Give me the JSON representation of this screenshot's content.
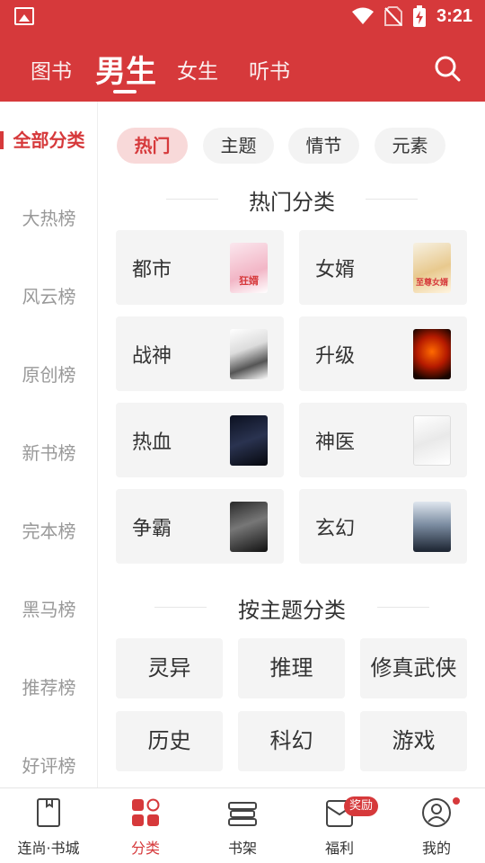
{
  "status_bar": {
    "time": "3:21"
  },
  "header": {
    "tabs": [
      {
        "label": "图书",
        "active": false
      },
      {
        "label": "男生",
        "active": true
      },
      {
        "label": "女生",
        "active": false
      },
      {
        "label": "听书",
        "active": false
      }
    ],
    "search_icon": "search-icon"
  },
  "sidebar": {
    "items": [
      {
        "label": "全部分类",
        "active": true
      },
      {
        "label": "大热榜"
      },
      {
        "label": "风云榜"
      },
      {
        "label": "原创榜"
      },
      {
        "label": "新书榜"
      },
      {
        "label": "完本榜"
      },
      {
        "label": "黑马榜"
      },
      {
        "label": "推荐榜"
      },
      {
        "label": "好评榜"
      }
    ]
  },
  "chips": [
    {
      "label": "热门",
      "active": true
    },
    {
      "label": "主题"
    },
    {
      "label": "情节"
    },
    {
      "label": "元素"
    }
  ],
  "hot_section": {
    "title": "热门分类",
    "categories": [
      {
        "label": "都市",
        "cover_text": "狂婿"
      },
      {
        "label": "女婿",
        "cover_text": "至尊女婿"
      },
      {
        "label": "战神",
        "cover_text": ""
      },
      {
        "label": "升级",
        "cover_text": ""
      },
      {
        "label": "热血",
        "cover_text": ""
      },
      {
        "label": "神医",
        "cover_text": ""
      },
      {
        "label": "争霸",
        "cover_text": ""
      },
      {
        "label": "玄幻",
        "cover_text": ""
      }
    ]
  },
  "theme_section": {
    "title": "按主题分类",
    "items": [
      {
        "label": "灵异"
      },
      {
        "label": "推理"
      },
      {
        "label": "修真武侠"
      },
      {
        "label": "历史"
      },
      {
        "label": "科幻"
      },
      {
        "label": "游戏"
      }
    ]
  },
  "bottom_nav": {
    "items": [
      {
        "label": "连尚·书城",
        "icon": "book-icon"
      },
      {
        "label": "分类",
        "icon": "category-grid-icon",
        "active": true
      },
      {
        "label": "书架",
        "icon": "bookshelf-icon"
      },
      {
        "label": "福利",
        "icon": "gift-envelope-icon",
        "badge": "奖励"
      },
      {
        "label": "我的",
        "icon": "profile-icon"
      }
    ]
  },
  "colors": {
    "accent": "#d6393b",
    "card_bg": "#f4f4f4",
    "chip_active_bg": "#f8d9d9"
  }
}
